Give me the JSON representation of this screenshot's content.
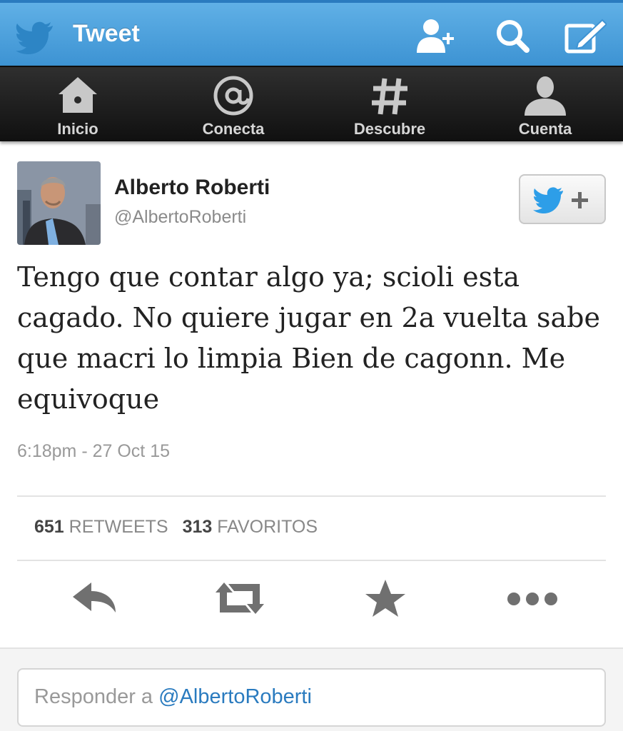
{
  "header": {
    "title": "Tweet",
    "icons": [
      "twitter-bird-icon",
      "add-user-icon",
      "search-icon",
      "compose-icon"
    ]
  },
  "nav": {
    "items": [
      {
        "label": "Inicio",
        "icon": "home-icon"
      },
      {
        "label": "Conecta",
        "icon": "at-icon"
      },
      {
        "label": "Descubre",
        "icon": "hashtag-icon"
      },
      {
        "label": "Cuenta",
        "icon": "person-icon"
      }
    ]
  },
  "tweet": {
    "author_name": "Alberto Roberti",
    "author_handle": "@AlbertoRoberti",
    "text": "Tengo que contar algo ya; scioli esta cagado. No quiere jugar en 2a vuelta sabe que macri lo limpia Bien de cagonn. Me equivoque",
    "timestamp": "6:18pm - 27 Oct 15",
    "retweets_count": "651",
    "retweets_label": "RETWEETS",
    "favorites_count": "313",
    "favorites_label": "FAVORITOS"
  },
  "actions": [
    "reply-icon",
    "retweet-icon",
    "favorite-star-icon",
    "more-icon"
  ],
  "reply": {
    "placeholder_prefix": "Responder a",
    "placeholder_mention": "@AlbertoRoberti"
  },
  "colors": {
    "header_blue": "#4ba3df",
    "nav_dark": "#1c1c1c",
    "link_blue": "#2a7bbf"
  }
}
